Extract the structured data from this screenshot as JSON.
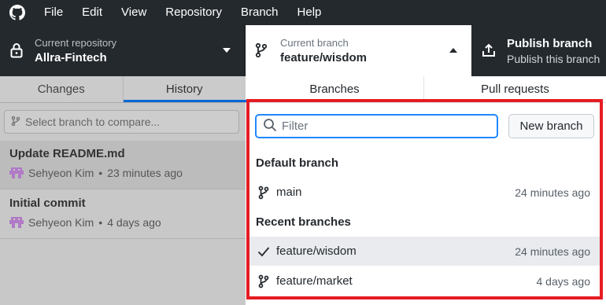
{
  "menubar": {
    "items": [
      "File",
      "Edit",
      "View",
      "Repository",
      "Branch",
      "Help"
    ]
  },
  "toolbar": {
    "repository": {
      "label": "Current repository",
      "value": "Allra-Fintech"
    },
    "branch": {
      "label": "Current branch",
      "value": "feature/wisdom"
    },
    "publish": {
      "title": "Publish branch",
      "subtitle": "Publish this branch"
    }
  },
  "left_pane": {
    "tabs": [
      "Changes",
      "History"
    ],
    "active_tab": "History",
    "compare_placeholder": "Select branch to compare...",
    "commits": [
      {
        "title": "Update README.md",
        "author": "Sehyeon Kim",
        "time": "23 minutes ago"
      },
      {
        "title": "Initial commit",
        "author": "Sehyeon Kim",
        "time": "4 days ago"
      }
    ]
  },
  "branch_dropdown": {
    "tabs": [
      "Branches",
      "Pull requests"
    ],
    "active_tab": "Branches",
    "filter": {
      "placeholder": "Filter",
      "value": ""
    },
    "new_branch_label": "New branch",
    "default_header": "Default branch",
    "default_branches": [
      {
        "name": "main",
        "time": "24 minutes ago",
        "current": false
      }
    ],
    "recent_header": "Recent branches",
    "recent_branches": [
      {
        "name": "feature/wisdom",
        "time": "24 minutes ago",
        "current": true
      },
      {
        "name": "feature/market",
        "time": "4 days ago",
        "current": false
      }
    ]
  },
  "colors": {
    "toolbar_bg": "#24292e",
    "accent": "#0366d6",
    "highlight": "#e51c23"
  }
}
